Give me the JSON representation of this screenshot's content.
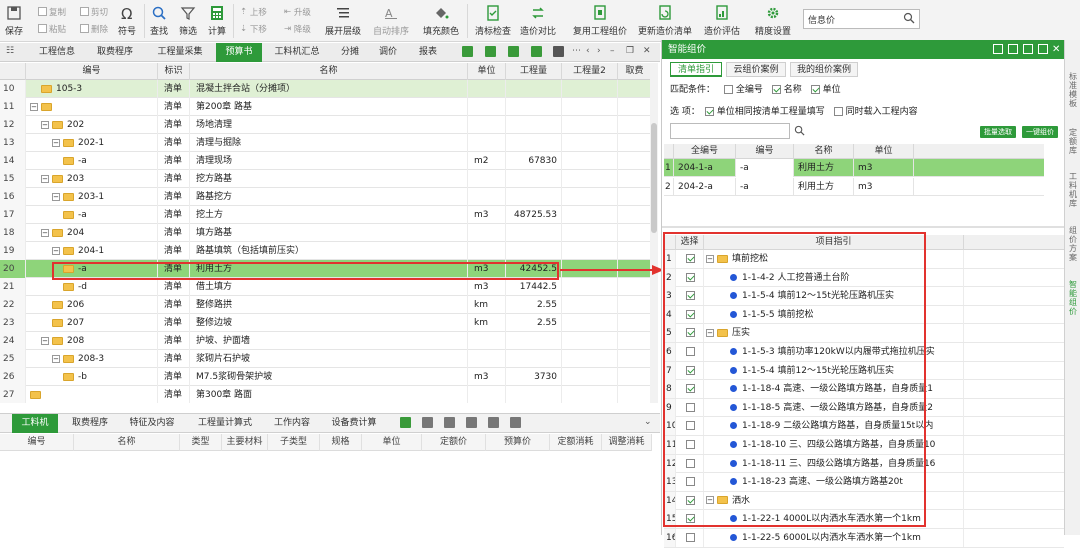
{
  "toolbar": {
    "save": "保存",
    "copy": "复制",
    "cut": "剪切",
    "paste": "粘贴",
    "delete": "删除",
    "symbol": "符号",
    "find": "查找",
    "filter": "筛选",
    "calc": "计算",
    "move_up": "上移",
    "upgrade": "升级",
    "move_down": "下移",
    "downgrade": "降级",
    "expand_level": "展开层级",
    "auto_sort": "自动排序",
    "fill_color": "填充颜色",
    "list_check": "清标检查",
    "price_compare": "造价对比",
    "reuse_pricing": "复用工程组价",
    "update_list": "更新造价清单",
    "price_eval": "造价评估",
    "precision_settings": "精度设置",
    "search_value": "信息价"
  },
  "tabs": [
    "工程信息",
    "取费程序",
    "工程量采集",
    "预算书",
    "工料机汇总",
    "分摊",
    "调价",
    "报表"
  ],
  "active_tab": "预算书",
  "grid": {
    "headers": [
      "编号",
      "标识",
      "名称",
      "单位",
      "工程量",
      "工程量2",
      "取费"
    ],
    "rows": [
      {
        "n": "10",
        "code": "105-3",
        "tag": "清单",
        "name": "混凝土拌合站（分摊项）",
        "unit": "",
        "qty": ""
      },
      {
        "n": "11",
        "code": "",
        "tag": "清单",
        "name": "第200章  路基",
        "unit": "",
        "qty": ""
      },
      {
        "n": "12",
        "code": "202",
        "tag": "清单",
        "name": "场地清理",
        "unit": "",
        "qty": ""
      },
      {
        "n": "13",
        "code": "202-1",
        "tag": "清单",
        "name": "清理与掘除",
        "unit": "",
        "qty": ""
      },
      {
        "n": "14",
        "code": "-a",
        "tag": "清单",
        "name": "清理现场",
        "unit": "m2",
        "qty": "67830"
      },
      {
        "n": "15",
        "code": "203",
        "tag": "清单",
        "name": "挖方路基",
        "unit": "",
        "qty": ""
      },
      {
        "n": "16",
        "code": "203-1",
        "tag": "清单",
        "name": "路基挖方",
        "unit": "",
        "qty": ""
      },
      {
        "n": "17",
        "code": "-a",
        "tag": "清单",
        "name": "挖土方",
        "unit": "m3",
        "qty": "48725.53"
      },
      {
        "n": "18",
        "code": "204",
        "tag": "清单",
        "name": "填方路基",
        "unit": "",
        "qty": ""
      },
      {
        "n": "19",
        "code": "204-1",
        "tag": "清单",
        "name": "路基填筑（包括填前压实）",
        "unit": "",
        "qty": ""
      },
      {
        "n": "20",
        "code": "-a",
        "tag": "清单",
        "name": "利用土方",
        "unit": "m3",
        "qty": "42452.5"
      },
      {
        "n": "21",
        "code": "-d",
        "tag": "清单",
        "name": "借土填方",
        "unit": "m3",
        "qty": "17442.5"
      },
      {
        "n": "22",
        "code": "206",
        "tag": "清单",
        "name": "整修路拱",
        "unit": "km",
        "qty": "2.55"
      },
      {
        "n": "23",
        "code": "207",
        "tag": "清单",
        "name": "整修边坡",
        "unit": "km",
        "qty": "2.55"
      },
      {
        "n": "24",
        "code": "208",
        "tag": "清单",
        "name": "护坡、护面墙",
        "unit": "",
        "qty": ""
      },
      {
        "n": "25",
        "code": "208-3",
        "tag": "清单",
        "name": "浆砌片石护坡",
        "unit": "",
        "qty": ""
      },
      {
        "n": "26",
        "code": "-b",
        "tag": "清单",
        "name": "M7.5浆砌骨架护坡",
        "unit": "m3",
        "qty": "3730"
      },
      {
        "n": "27",
        "code": "",
        "tag": "清单",
        "name": "第300章  路面",
        "unit": "",
        "qty": ""
      }
    ]
  },
  "bottom": {
    "tabs": [
      "工料机",
      "取费程序",
      "特征及内容",
      "工程量计算式",
      "工作内容",
      "设备费计算"
    ],
    "active": "工料机",
    "headers": [
      "编号",
      "名称",
      "类型",
      "主要材料",
      "子类型",
      "规格",
      "单位",
      "定额价",
      "预算价",
      "定额消耗",
      "调整消耗"
    ]
  },
  "smart": {
    "title": "智能组价",
    "tabs": [
      "清单指引",
      "云组价案例",
      "我的组价案例"
    ],
    "match_label": "匹配条件：",
    "opt_code": "全编号",
    "opt_name": "名称",
    "opt_unit": "单位",
    "select_label": "选    项：",
    "opt_same_unit": "单位相同按清单工程量填写",
    "opt_load_content": "同时载入工程内容",
    "batch_btn": "批量选取",
    "one_click_btn": "一键组价",
    "match_headers": [
      "全编号",
      "编号",
      "名称",
      "单位"
    ],
    "match_rows": [
      {
        "n": "1",
        "full": "204-1-a",
        "code": "-a",
        "name": "利用土方",
        "unit": "m3"
      },
      {
        "n": "2",
        "full": "204-2-a",
        "code": "-a",
        "name": "利用土方",
        "unit": "m3"
      }
    ],
    "item_headers": [
      "选择",
      "项目指引"
    ],
    "items": [
      {
        "n": "1",
        "checked": true,
        "group": true,
        "text": "填前挖松"
      },
      {
        "n": "2",
        "checked": true,
        "group": false,
        "text": "1-1-4-2 人工挖普通土台阶"
      },
      {
        "n": "3",
        "checked": true,
        "group": false,
        "text": "1-1-5-4 填前12～15t光轮压路机压实"
      },
      {
        "n": "4",
        "checked": true,
        "group": false,
        "text": "1-1-5-5 填前挖松"
      },
      {
        "n": "5",
        "checked": true,
        "group": true,
        "text": "压实"
      },
      {
        "n": "6",
        "checked": false,
        "group": false,
        "text": "1-1-5-3 填前功率120kW以内履带式拖拉机压实"
      },
      {
        "n": "7",
        "checked": true,
        "group": false,
        "text": "1-1-5-4 填前12～15t光轮压路机压实"
      },
      {
        "n": "8",
        "checked": true,
        "group": false,
        "text": "1-1-18-4 高速、一级公路填方路基，自身质量1"
      },
      {
        "n": "9",
        "checked": false,
        "group": false,
        "text": "1-1-18-5 高速、一级公路填方路基，自身质量2"
      },
      {
        "n": "10",
        "checked": false,
        "group": false,
        "text": "1-1-18-9 二级公路填方路基，自身质量15t以内"
      },
      {
        "n": "11",
        "checked": false,
        "group": false,
        "text": "1-1-18-10 三、四级公路填方路基，自身质量10"
      },
      {
        "n": "12",
        "checked": false,
        "group": false,
        "text": "1-1-18-11 三、四级公路填方路基，自身质量16"
      },
      {
        "n": "13",
        "checked": false,
        "group": false,
        "text": "1-1-18-23 高速、一级公路填方路基20t"
      },
      {
        "n": "14",
        "checked": true,
        "group": true,
        "text": "洒水"
      },
      {
        "n": "15",
        "checked": true,
        "group": false,
        "text": "1-1-22-1 4000L以内洒水车洒水第一个1km"
      },
      {
        "n": "16",
        "checked": false,
        "group": false,
        "text": "1-1-22-5 6000L以内洒水车洒水第一个1km"
      }
    ]
  },
  "right_side_tabs": [
    "标准模板",
    "定额库",
    "工料机库",
    "组价方案",
    "智能组价"
  ],
  "colors": {
    "accent": "#2e9a3a",
    "highlight": "#8ed47a",
    "annotation": "#e2322e"
  }
}
